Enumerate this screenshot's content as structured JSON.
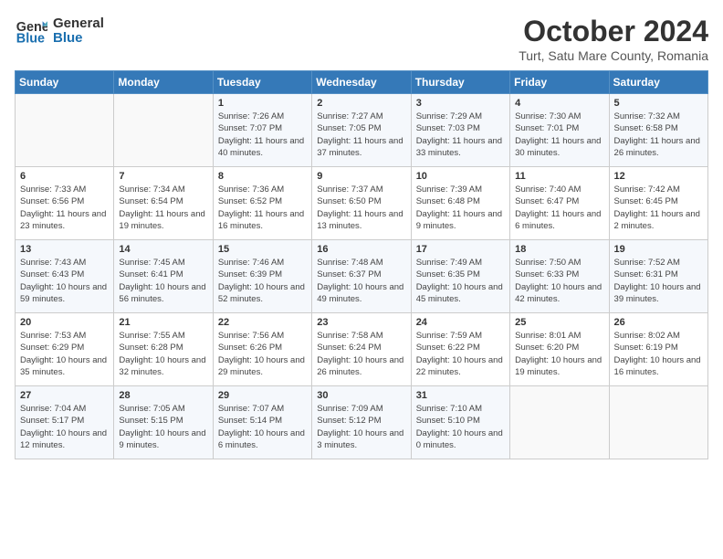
{
  "header": {
    "logo_line1": "General",
    "logo_line2": "Blue",
    "month": "October 2024",
    "location": "Turt, Satu Mare County, Romania"
  },
  "weekdays": [
    "Sunday",
    "Monday",
    "Tuesday",
    "Wednesday",
    "Thursday",
    "Friday",
    "Saturday"
  ],
  "weeks": [
    [
      {
        "day": "",
        "info": ""
      },
      {
        "day": "",
        "info": ""
      },
      {
        "day": "1",
        "info": "Sunrise: 7:26 AM\nSunset: 7:07 PM\nDaylight: 11 hours and 40 minutes."
      },
      {
        "day": "2",
        "info": "Sunrise: 7:27 AM\nSunset: 7:05 PM\nDaylight: 11 hours and 37 minutes."
      },
      {
        "day": "3",
        "info": "Sunrise: 7:29 AM\nSunset: 7:03 PM\nDaylight: 11 hours and 33 minutes."
      },
      {
        "day": "4",
        "info": "Sunrise: 7:30 AM\nSunset: 7:01 PM\nDaylight: 11 hours and 30 minutes."
      },
      {
        "day": "5",
        "info": "Sunrise: 7:32 AM\nSunset: 6:58 PM\nDaylight: 11 hours and 26 minutes."
      }
    ],
    [
      {
        "day": "6",
        "info": "Sunrise: 7:33 AM\nSunset: 6:56 PM\nDaylight: 11 hours and 23 minutes."
      },
      {
        "day": "7",
        "info": "Sunrise: 7:34 AM\nSunset: 6:54 PM\nDaylight: 11 hours and 19 minutes."
      },
      {
        "day": "8",
        "info": "Sunrise: 7:36 AM\nSunset: 6:52 PM\nDaylight: 11 hours and 16 minutes."
      },
      {
        "day": "9",
        "info": "Sunrise: 7:37 AM\nSunset: 6:50 PM\nDaylight: 11 hours and 13 minutes."
      },
      {
        "day": "10",
        "info": "Sunrise: 7:39 AM\nSunset: 6:48 PM\nDaylight: 11 hours and 9 minutes."
      },
      {
        "day": "11",
        "info": "Sunrise: 7:40 AM\nSunset: 6:47 PM\nDaylight: 11 hours and 6 minutes."
      },
      {
        "day": "12",
        "info": "Sunrise: 7:42 AM\nSunset: 6:45 PM\nDaylight: 11 hours and 2 minutes."
      }
    ],
    [
      {
        "day": "13",
        "info": "Sunrise: 7:43 AM\nSunset: 6:43 PM\nDaylight: 10 hours and 59 minutes."
      },
      {
        "day": "14",
        "info": "Sunrise: 7:45 AM\nSunset: 6:41 PM\nDaylight: 10 hours and 56 minutes."
      },
      {
        "day": "15",
        "info": "Sunrise: 7:46 AM\nSunset: 6:39 PM\nDaylight: 10 hours and 52 minutes."
      },
      {
        "day": "16",
        "info": "Sunrise: 7:48 AM\nSunset: 6:37 PM\nDaylight: 10 hours and 49 minutes."
      },
      {
        "day": "17",
        "info": "Sunrise: 7:49 AM\nSunset: 6:35 PM\nDaylight: 10 hours and 45 minutes."
      },
      {
        "day": "18",
        "info": "Sunrise: 7:50 AM\nSunset: 6:33 PM\nDaylight: 10 hours and 42 minutes."
      },
      {
        "day": "19",
        "info": "Sunrise: 7:52 AM\nSunset: 6:31 PM\nDaylight: 10 hours and 39 minutes."
      }
    ],
    [
      {
        "day": "20",
        "info": "Sunrise: 7:53 AM\nSunset: 6:29 PM\nDaylight: 10 hours and 35 minutes."
      },
      {
        "day": "21",
        "info": "Sunrise: 7:55 AM\nSunset: 6:28 PM\nDaylight: 10 hours and 32 minutes."
      },
      {
        "day": "22",
        "info": "Sunrise: 7:56 AM\nSunset: 6:26 PM\nDaylight: 10 hours and 29 minutes."
      },
      {
        "day": "23",
        "info": "Sunrise: 7:58 AM\nSunset: 6:24 PM\nDaylight: 10 hours and 26 minutes."
      },
      {
        "day": "24",
        "info": "Sunrise: 7:59 AM\nSunset: 6:22 PM\nDaylight: 10 hours and 22 minutes."
      },
      {
        "day": "25",
        "info": "Sunrise: 8:01 AM\nSunset: 6:20 PM\nDaylight: 10 hours and 19 minutes."
      },
      {
        "day": "26",
        "info": "Sunrise: 8:02 AM\nSunset: 6:19 PM\nDaylight: 10 hours and 16 minutes."
      }
    ],
    [
      {
        "day": "27",
        "info": "Sunrise: 7:04 AM\nSunset: 5:17 PM\nDaylight: 10 hours and 12 minutes."
      },
      {
        "day": "28",
        "info": "Sunrise: 7:05 AM\nSunset: 5:15 PM\nDaylight: 10 hours and 9 minutes."
      },
      {
        "day": "29",
        "info": "Sunrise: 7:07 AM\nSunset: 5:14 PM\nDaylight: 10 hours and 6 minutes."
      },
      {
        "day": "30",
        "info": "Sunrise: 7:09 AM\nSunset: 5:12 PM\nDaylight: 10 hours and 3 minutes."
      },
      {
        "day": "31",
        "info": "Sunrise: 7:10 AM\nSunset: 5:10 PM\nDaylight: 10 hours and 0 minutes."
      },
      {
        "day": "",
        "info": ""
      },
      {
        "day": "",
        "info": ""
      }
    ]
  ]
}
